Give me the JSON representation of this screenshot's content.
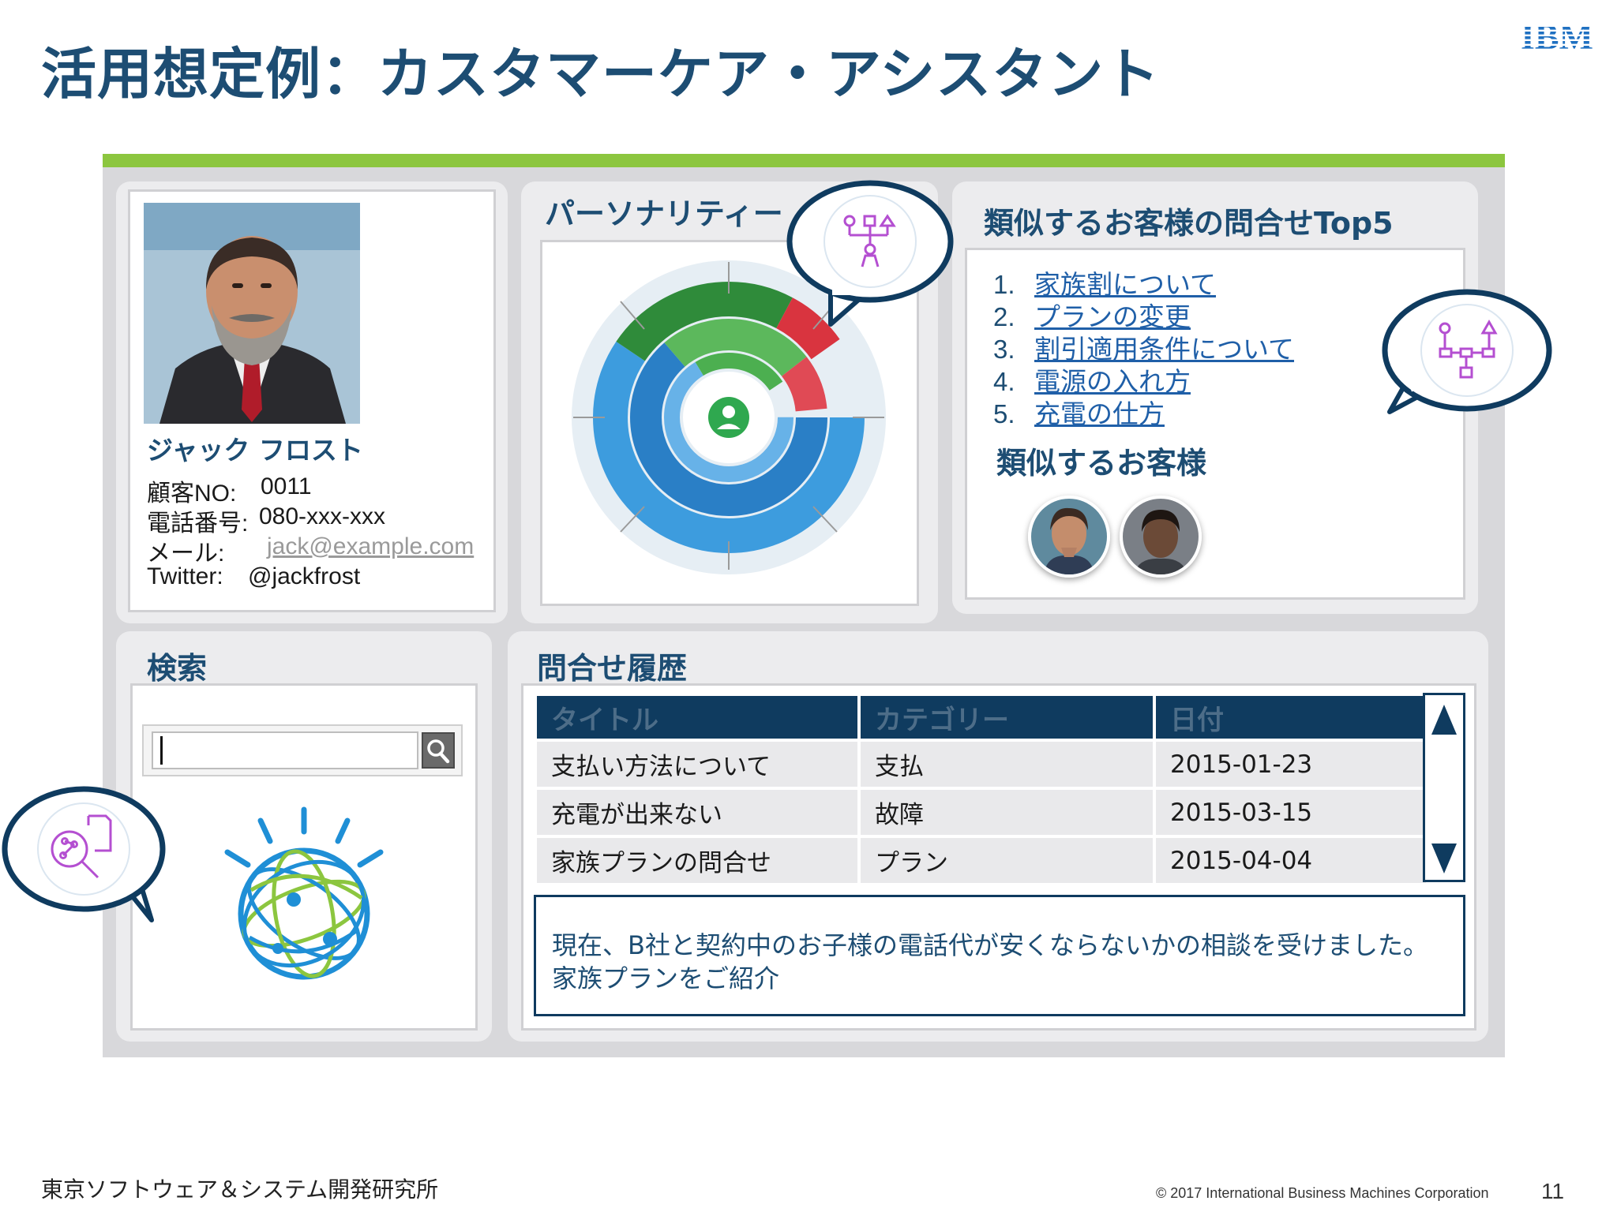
{
  "slide": {
    "title": "活用想定例：カスタマーケア・アシスタント",
    "logo_text": "IBM"
  },
  "profile": {
    "name": "ジャック フロスト",
    "customer_no_label": "顧客NO:",
    "customer_no": "0011",
    "phone_label": "電話番号:",
    "phone": "080-xxx-xxx",
    "email_label": "メール:",
    "email": "jack@example.com",
    "twitter_label": "Twitter:",
    "twitter": "@jackfrost"
  },
  "personality": {
    "title": "パーソナリティー"
  },
  "similar": {
    "title": "類似するお客様の問合せTop5",
    "items": [
      {
        "num": "1.",
        "label": "家族割について"
      },
      {
        "num": "2.",
        "label": "プランの変更"
      },
      {
        "num": "3.",
        "label": "割引適用条件について"
      },
      {
        "num": "4.",
        "label": "電源の入れ方"
      },
      {
        "num": "5.",
        "label": "充電の仕方"
      }
    ],
    "customers_title": "類似するお客様"
  },
  "search": {
    "title": "検索",
    "value": ""
  },
  "history": {
    "title": "問合せ履歴",
    "columns": [
      "タイトル",
      "カテゴリー",
      "日付"
    ],
    "rows": [
      [
        "支払い方法について",
        "支払",
        "2015-01-23"
      ],
      [
        "充電が出来ない",
        "故障",
        "2015-03-15"
      ],
      [
        "家族プランの問合せ",
        "プラン",
        "2015-04-04"
      ]
    ],
    "note": "現在、B社と契約中のお子様の電話代が安くならないかの相談を受けました。家族プランをご紹介"
  },
  "footer": {
    "org": "東京ソフトウェア＆システム開発研究所",
    "copyright": "© 2017 International Business Machines Corporation",
    "page": "11"
  },
  "colors": {
    "title_blue": "#1d4d73",
    "accent_green": "#8cc63f",
    "header_navy": "#0f3b5f",
    "link_blue": "#1f5fa8",
    "chart_blue": "#2a8fd6",
    "chart_green": "#5cb85c",
    "chart_red": "#d9343f",
    "icon_purple": "#b44fd1"
  },
  "icons": [
    "search-icon",
    "hierarchy-icon",
    "discovery-icon",
    "watson-logo-icon",
    "scroll-up-icon",
    "scroll-down-icon"
  ]
}
